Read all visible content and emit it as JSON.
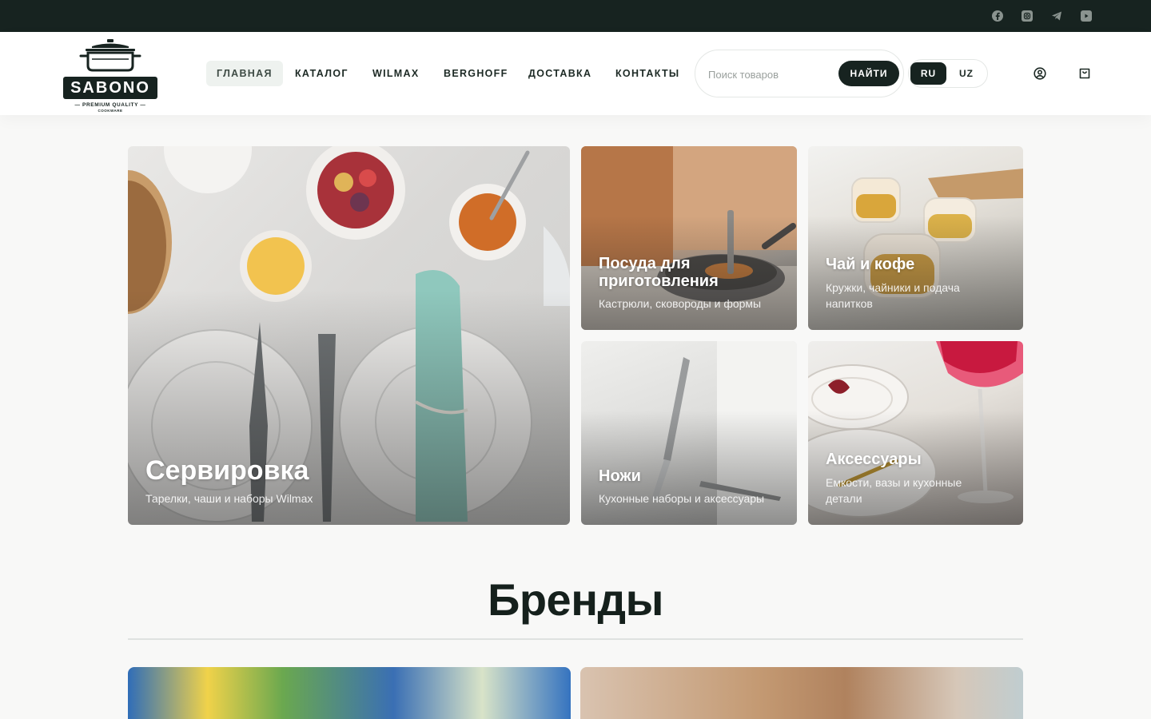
{
  "topbar": {
    "social": [
      "facebook-icon",
      "instagram-icon",
      "telegram-icon",
      "youtube-icon"
    ]
  },
  "header": {
    "logo": {
      "name": "SABONO",
      "tagline": "— PREMIUM QUALITY —",
      "sub": "COOKWARE"
    },
    "nav": [
      "ГЛАВНАЯ",
      "КАТАЛОГ",
      "WILMAX",
      "BERGHOFF",
      "ДОСТАВКА",
      "КОНТАКТЫ"
    ],
    "active_nav": "ГЛАВНАЯ",
    "search": {
      "placeholder": "Поиск товаров",
      "value": "",
      "button": "НАЙТИ"
    },
    "lang": {
      "options": [
        "RU",
        "UZ"
      ],
      "selected": "RU"
    },
    "icons": [
      "user-icon",
      "cart-icon"
    ]
  },
  "categories": [
    {
      "title": "Сервировка",
      "subtitle": "Тарелки, чаши и наборы Wilmax"
    },
    {
      "title": "Посуда для приготовления",
      "subtitle": "Кастрюли, сковороды и формы"
    },
    {
      "title": "Чай и кофе",
      "subtitle": "Кружки, чайники и подача напитков"
    },
    {
      "title": "Ножи",
      "subtitle": "Кухонные наборы и аксессуары"
    },
    {
      "title": "Аксессуары",
      "subtitle": "Емкости, вазы и кухонные детали"
    }
  ],
  "brands": {
    "title": "Бренды"
  },
  "colors": {
    "dark": "#172320",
    "background": "#f8f8f7",
    "active_nav_bg": "#eef2ef"
  }
}
